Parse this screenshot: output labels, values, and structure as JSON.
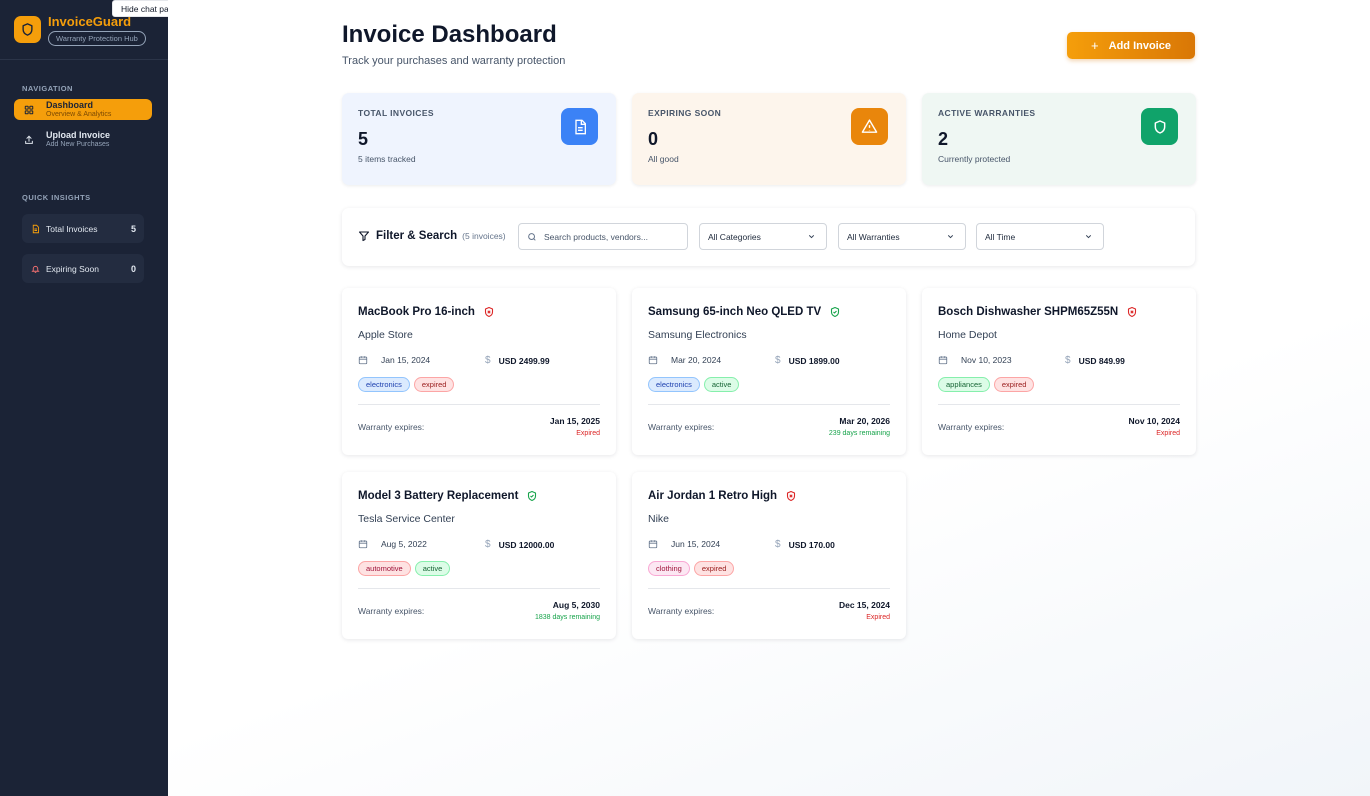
{
  "colors": {
    "accent": "#f59e0b",
    "sidebar": "#1b2336",
    "expired": "#dc2626",
    "active": "#16a34a"
  },
  "tooltip": {
    "text": "Hide chat panel"
  },
  "brand": {
    "name": "InvoiceGuard",
    "tagline": "Warranty Protection Hub"
  },
  "sidebar": {
    "nav_label": "NAVIGATION",
    "items": [
      {
        "title": "Dashboard",
        "subtitle": "Overview & Analytics",
        "icon": "grid-icon",
        "active": true
      },
      {
        "title": "Upload Invoice",
        "subtitle": "Add New Purchases",
        "icon": "upload-icon",
        "active": false
      }
    ],
    "insights_label": "QUICK INSIGHTS",
    "insights": [
      {
        "label": "Total Invoices",
        "count": "5",
        "icon": "document-icon"
      },
      {
        "label": "Expiring Soon",
        "count": "0",
        "icon": "bell-icon"
      }
    ]
  },
  "header": {
    "title": "Invoice Dashboard",
    "subtitle": "Track your purchases and warranty protection",
    "add_button": "Add Invoice"
  },
  "stats": [
    {
      "label": "TOTAL INVOICES",
      "value": "5",
      "sub": "5 items tracked",
      "icon": "document-icon"
    },
    {
      "label": "EXPIRING SOON",
      "value": "0",
      "sub": "All good",
      "icon": "warning-icon"
    },
    {
      "label": "ACTIVE WARRANTIES",
      "value": "2",
      "sub": "Currently protected",
      "icon": "shield-icon"
    }
  ],
  "filter": {
    "title": "Filter & Search",
    "count": "(5 invoices)",
    "search_placeholder": "Search products, vendors...",
    "category": "All Categories",
    "warranty": "All Warranties",
    "time": "All Time"
  },
  "invoices": [
    {
      "product": "MacBook Pro 16-inch",
      "vendor": "Apple Store",
      "date": "Jan 15, 2024",
      "price": "USD 2499.99",
      "category": "electronics",
      "status": "expired",
      "warranty_label": "Warranty expires:",
      "warranty_date": "Jan 15, 2025",
      "warranty_status": "Expired"
    },
    {
      "product": "Samsung 65-inch Neo QLED TV",
      "vendor": "Samsung Electronics",
      "date": "Mar 20, 2024",
      "price": "USD 1899.00",
      "category": "electronics",
      "status": "active",
      "warranty_label": "Warranty expires:",
      "warranty_date": "Mar 20, 2026",
      "warranty_status": "239 days remaining"
    },
    {
      "product": "Bosch Dishwasher SHPM65Z55N",
      "vendor": "Home Depot",
      "date": "Nov 10, 2023",
      "price": "USD 849.99",
      "category": "appliances",
      "status": "expired",
      "warranty_label": "Warranty expires:",
      "warranty_date": "Nov 10, 2024",
      "warranty_status": "Expired"
    },
    {
      "product": "Model 3 Battery Replacement",
      "vendor": "Tesla Service Center",
      "date": "Aug 5, 2022",
      "price": "USD 12000.00",
      "category": "automotive",
      "status": "active",
      "warranty_label": "Warranty expires:",
      "warranty_date": "Aug 5, 2030",
      "warranty_status": "1838 days remaining"
    },
    {
      "product": "Air Jordan 1 Retro High",
      "vendor": "Nike",
      "date": "Jun 15, 2024",
      "price": "USD 170.00",
      "category": "clothing",
      "status": "expired",
      "warranty_label": "Warranty expires:",
      "warranty_date": "Dec 15, 2024",
      "warranty_status": "Expired"
    }
  ]
}
